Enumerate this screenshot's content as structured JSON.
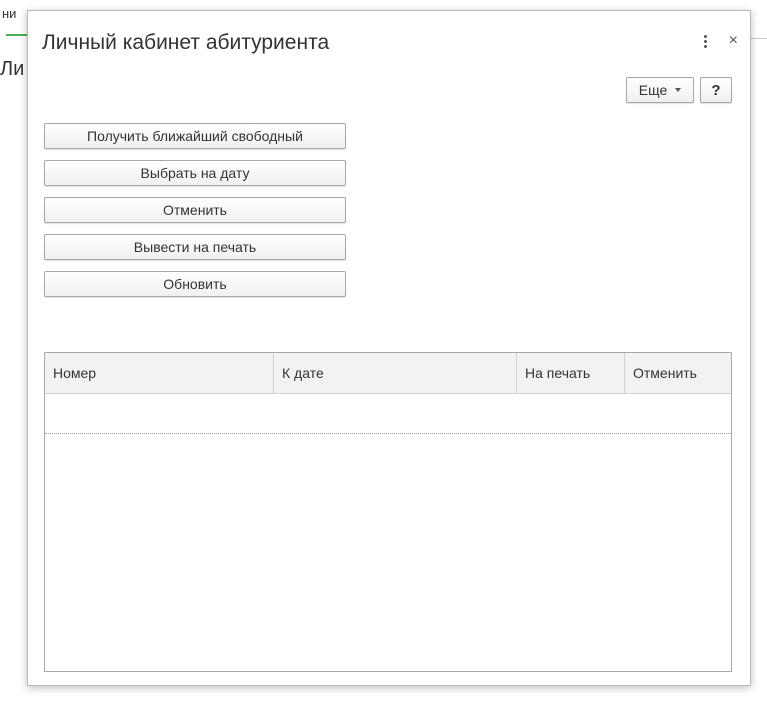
{
  "background": {
    "tab_text": "ни",
    "heading_fragment": "Ли"
  },
  "dialog": {
    "title": "Личный кабинет абитуриента",
    "icons": {
      "more_vertical": "kebab-icon",
      "close": "×"
    },
    "toolbar": {
      "more_label": "Еще",
      "help_label": "?"
    },
    "actions": [
      "Получить ближайший свободный",
      "Выбрать на дату",
      "Отменить",
      "Вывести на печать",
      "Обновить"
    ],
    "table": {
      "columns": [
        "Номер",
        "К дате",
        "На печать",
        "Отменить"
      ],
      "rows": []
    }
  },
  "colors": {
    "accent_underline": "#4caf50",
    "border": "#a8a8a8"
  }
}
